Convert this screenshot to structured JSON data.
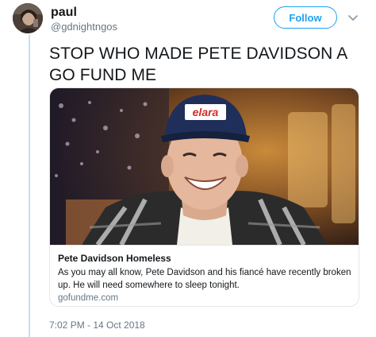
{
  "user": {
    "display_name": "paul",
    "handle": "@gdnightngos"
  },
  "follow_label": "Follow",
  "tweet": {
    "text": "STOP WHO MADE PETE DAVIDSON A GO FUND ME"
  },
  "card": {
    "cap_text": "elara",
    "title": "Pete Davidson Homeless",
    "description": "As you may all know, Pete Davidson and his fiancé  have recently broken up. He will need somewhere to sleep tonight.",
    "domain": "gofundme.com"
  },
  "timestamp": "7:02 PM - 14 Oct 2018",
  "colors": {
    "accent": "#1da1f2",
    "thread_line": "#c4e0f5",
    "muted": "#657786",
    "border": "#e1e8ed"
  }
}
